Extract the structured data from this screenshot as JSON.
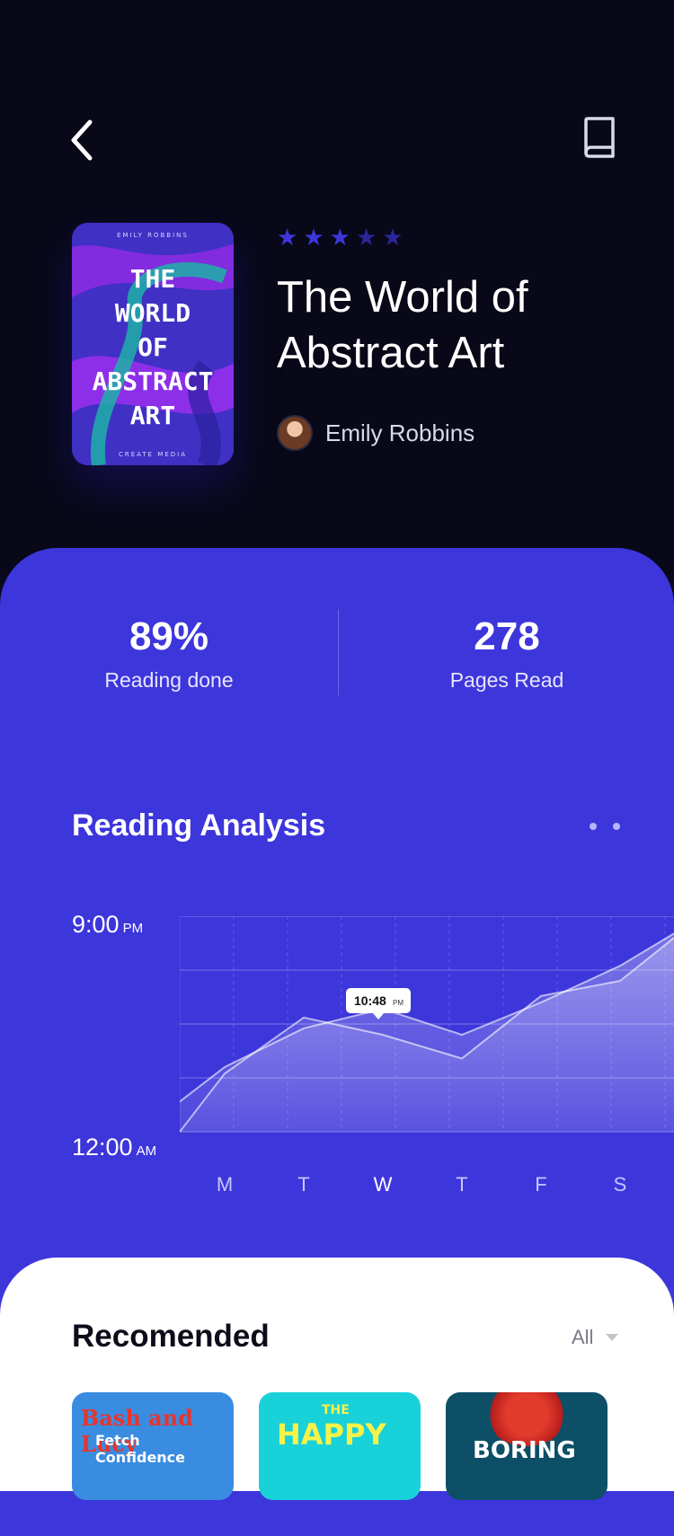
{
  "header": {
    "back_icon": "chevron-left-icon",
    "book_icon": "book-icon"
  },
  "book": {
    "cover_author": "EMILY ROBBINS",
    "cover_title": "THE\nWORLD\nOF\nABSTRACT\nART",
    "cover_publisher": "CREATE MEDIA",
    "rating": 5,
    "title": "The World of\nAbstract Art",
    "author": "Emily Robbins"
  },
  "stats": {
    "reading_done_value": "89%",
    "reading_done_label": "Reading done",
    "pages_read_value": "278",
    "pages_read_label": "Pages Read"
  },
  "analysis": {
    "title": "Reading Analysis",
    "y_top_time": "9:00",
    "y_top_ampm": "PM",
    "y_bottom_time": "12:00",
    "y_bottom_ampm": "AM",
    "tooltip": "10:48",
    "tooltip_ampm": "PM",
    "days": [
      "M",
      "T",
      "W",
      "T",
      "F",
      "S"
    ],
    "active_day_index": 2
  },
  "colors": {
    "panel": "#3d36db",
    "star_active": "#3d36db",
    "star_inactive": "#2a269c"
  },
  "chart_data": {
    "type": "area",
    "title": "",
    "xlabel": "",
    "ylabel": "",
    "categories": [
      "M",
      "T",
      "W",
      "T",
      "F",
      "S"
    ],
    "series": [
      {
        "values": [
          0.3,
          0.48,
          0.57,
          0.45,
          0.6,
          0.77
        ]
      },
      {
        "values": [
          0.27,
          0.53,
          0.45,
          0.34,
          0.63,
          0.7
        ]
      }
    ],
    "ylim": [
      0,
      1
    ],
    "grid": true
  },
  "recommended": {
    "title": "Recomended",
    "filter_label": "All",
    "books": [
      {
        "line1": "Bash and Lucy",
        "line2": "Fetch Confidence"
      },
      {
        "line1": "THE",
        "line2": "HAPPY"
      },
      {
        "line1": "BORING"
      }
    ]
  }
}
